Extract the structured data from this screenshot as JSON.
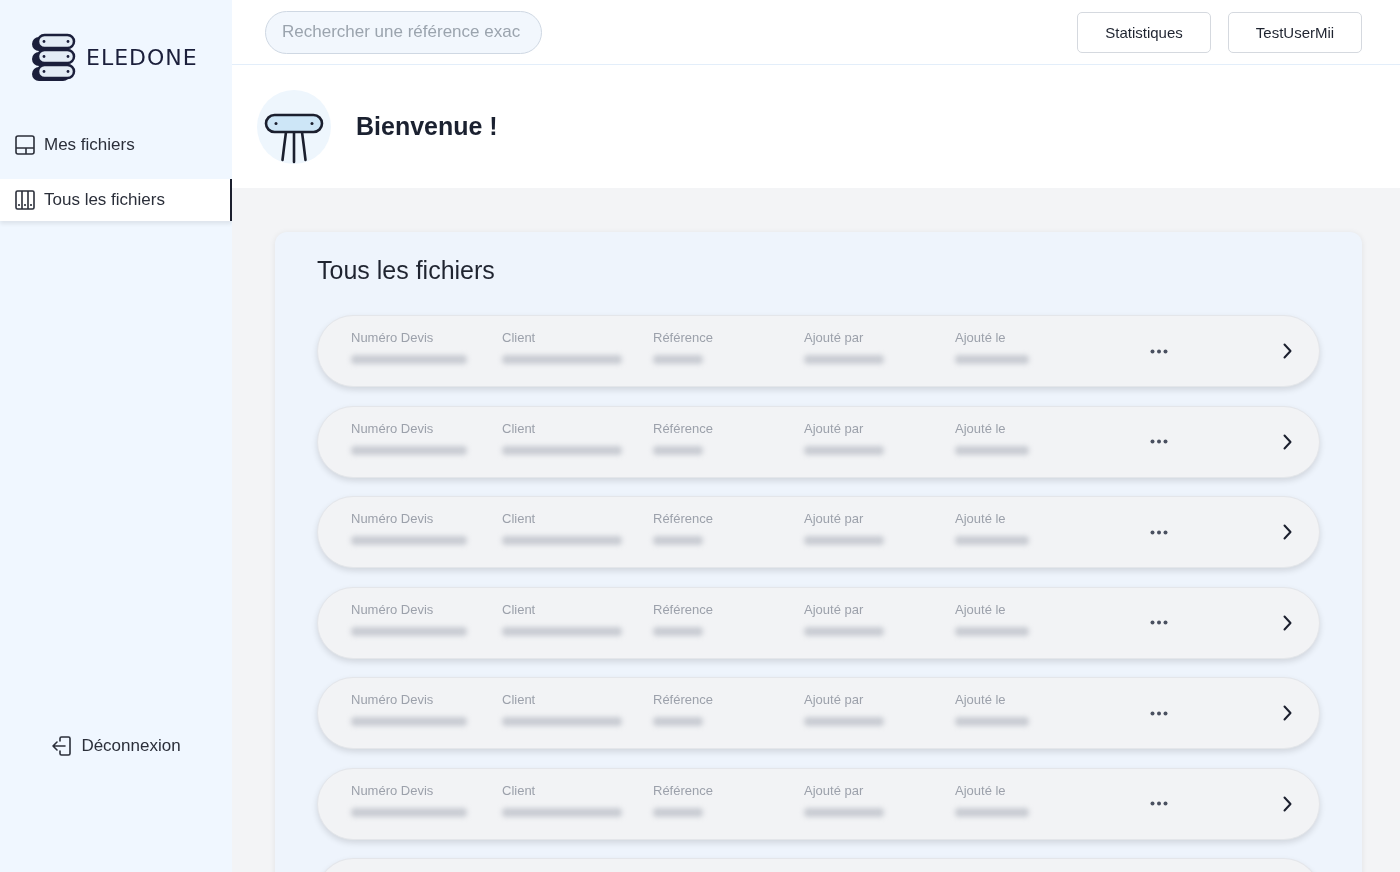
{
  "sidebar": {
    "logo": {
      "text": "ELEDONE"
    },
    "items": [
      {
        "label": "Mes fichiers",
        "selected": false
      },
      {
        "label": "Tous les fichiers",
        "selected": true
      }
    ],
    "logout": {
      "label": "Déconnexion"
    }
  },
  "topbar": {
    "search": {
      "placeholder": "Rechercher une référence exac"
    },
    "buttons": [
      "Statistiques",
      "TestUserMii"
    ]
  },
  "welcome": {
    "title": "Bienvenue !"
  },
  "files_panel": {
    "title": "Tous les fichiers",
    "rows": [
      {
        "fields": [
          {
            "label": "Numéro Devis",
            "value_hidden": true
          },
          {
            "label": "Client",
            "value_hidden": true
          },
          {
            "label": "Référence",
            "value_hidden": true
          },
          {
            "label": "Ajouté par",
            "value_hidden": true
          },
          {
            "label": "Ajouté le",
            "value_hidden": true
          }
        ]
      },
      {
        "fields": [
          {
            "label": "Numéro Devis",
            "value_hidden": true
          },
          {
            "label": "Client",
            "value_hidden": true
          },
          {
            "label": "Référence",
            "value_hidden": true
          },
          {
            "label": "Ajouté par",
            "value_hidden": true
          },
          {
            "label": "Ajouté le",
            "value_hidden": true
          }
        ]
      },
      {
        "fields": [
          {
            "label": "Numéro Devis",
            "value_hidden": true
          },
          {
            "label": "Client",
            "value_hidden": true
          },
          {
            "label": "Référence",
            "value_hidden": true
          },
          {
            "label": "Ajouté par",
            "value_hidden": true
          },
          {
            "label": "Ajouté le",
            "value_hidden": true
          }
        ]
      },
      {
        "fields": [
          {
            "label": "Numéro Devis",
            "value_hidden": true
          },
          {
            "label": "Client",
            "value_hidden": true
          },
          {
            "label": "Référence",
            "value_hidden": true
          },
          {
            "label": "Ajouté par",
            "value_hidden": true
          },
          {
            "label": "Ajouté le",
            "value_hidden": true
          }
        ]
      },
      {
        "fields": [
          {
            "label": "Numéro Devis",
            "value_hidden": true
          },
          {
            "label": "Client",
            "value_hidden": true
          },
          {
            "label": "Référence",
            "value_hidden": true
          },
          {
            "label": "Ajouté par",
            "value_hidden": true
          },
          {
            "label": "Ajouté le",
            "value_hidden": true
          }
        ]
      },
      {
        "fields": [
          {
            "label": "Numéro Devis",
            "value_hidden": true
          },
          {
            "label": "Client",
            "value_hidden": true
          },
          {
            "label": "Référence",
            "value_hidden": true
          },
          {
            "label": "Ajouté par",
            "value_hidden": true
          },
          {
            "label": "Ajouté le",
            "value_hidden": true
          }
        ]
      }
    ],
    "more_rows_below": true
  }
}
